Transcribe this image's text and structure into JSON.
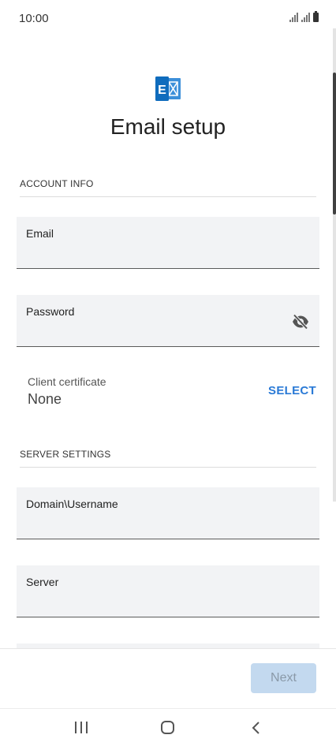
{
  "status_bar": {
    "time": "10:00"
  },
  "header": {
    "title": "Email setup",
    "logo_letter": "E"
  },
  "account_info": {
    "section_label": "ACCOUNT INFO",
    "email_label": "Email",
    "password_label": "Password"
  },
  "certificate": {
    "label": "Client certificate",
    "value": "None",
    "select_label": "SELECT"
  },
  "server_settings": {
    "section_label": "SERVER SETTINGS",
    "domain_label": "Domain\\Username",
    "server_label": "Server"
  },
  "footer": {
    "next_label": "Next"
  },
  "colors": {
    "accent": "#2a7ad6",
    "exchange_blue": "#0f6cbd",
    "field_bg": "#f2f3f5",
    "next_disabled_bg": "#c3d9ef"
  },
  "icons": {
    "logo": "exchange-icon",
    "password_toggle": "eye-off-icon",
    "nav_recents": "recents-icon",
    "nav_home": "home-icon",
    "nav_back": "back-icon"
  }
}
